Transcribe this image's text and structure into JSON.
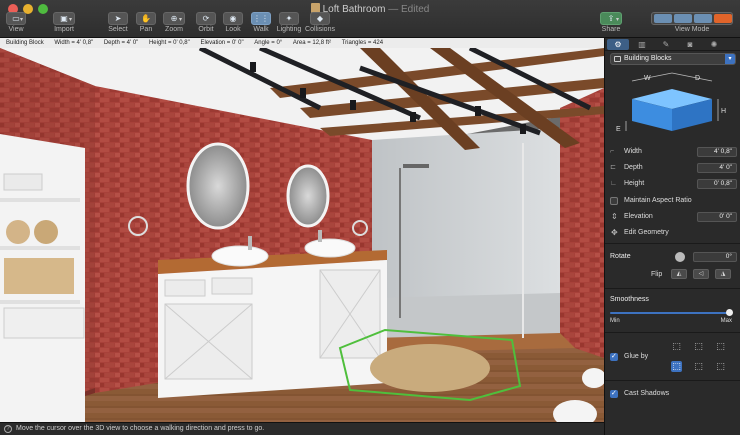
{
  "window": {
    "title": "Loft Bathroom",
    "edited": "— Edited"
  },
  "toolbar": {
    "view": "View",
    "import": "Import",
    "select": "Select",
    "pan": "Pan",
    "zoom": "Zoom",
    "orbit": "Orbit",
    "look": "Look",
    "walk": "Walk",
    "lighting": "Lighting",
    "collisions": "Collisions",
    "share": "Share",
    "view_mode": "View Mode"
  },
  "infobar": {
    "object": "Building Block",
    "width": "Width = 4' 0,8\"",
    "depth": "Depth = 4' 0\"",
    "height": "Height = 0' 0,8\"",
    "elevation": "Elevation = 0' 0\"",
    "angle": "Angle = 0°",
    "area": "Area = 12,8 ft²",
    "triangles": "Triangles = 424"
  },
  "status": {
    "help_glyph": "?",
    "message": "Move the cursor over the 3D view to choose a walking direction and press to go."
  },
  "inspector": {
    "category": "Building Blocks",
    "dim_labels": {
      "w": "W",
      "d": "D",
      "h": "H",
      "e": "E"
    },
    "width_label": "Width",
    "width_value": "4' 0,8\"",
    "depth_label": "Depth",
    "depth_value": "4' 0\"",
    "height_label": "Height",
    "height_value": "0' 0,8\"",
    "maintain_aspect": "Maintain Aspect Ratio",
    "elevation_label": "Elevation",
    "elevation_value": "0' 0\"",
    "edit_geometry": "Edit Geometry",
    "rotate_label": "Rotate",
    "rotate_value": "0°",
    "flip_label": "Flip",
    "smoothness_label": "Smoothness",
    "smoothness_min": "Min",
    "smoothness_max": "Max",
    "smoothness_level": 1.0,
    "glue_by": "Glue by",
    "glue_by_checked": true,
    "cast_shadows": "Cast Shadows",
    "cast_shadows_checked": true,
    "maintain_aspect_checked": false
  },
  "colors": {
    "accent": "#3d72c0",
    "brick": "#a8413a",
    "floor": "#8a5a36",
    "box_blue": "#4a90d9"
  }
}
